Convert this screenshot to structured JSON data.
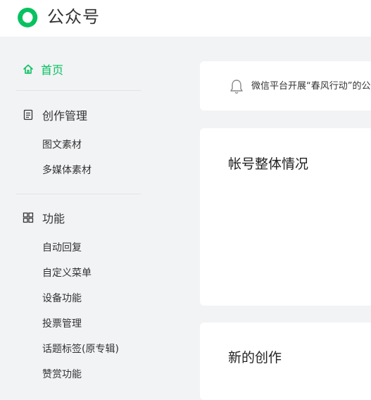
{
  "brand": {
    "name": "公众号",
    "color": "#07c160",
    "logo_icon": "wechat-official-account-logo"
  },
  "sidebar": {
    "home": {
      "label": "首页",
      "icon": "home-icon",
      "active": true
    },
    "groups": [
      {
        "label": "创作管理",
        "icon": "document-icon",
        "items": [
          {
            "label": "图文素材"
          },
          {
            "label": "多媒体素材"
          }
        ]
      },
      {
        "label": "功能",
        "icon": "grid-icon",
        "items": [
          {
            "label": "自动回复"
          },
          {
            "label": "自定义菜单"
          },
          {
            "label": "设备功能"
          },
          {
            "label": "投票管理"
          },
          {
            "label": "话题标签(原专辑)"
          },
          {
            "label": "赞赏功能"
          }
        ]
      }
    ]
  },
  "main": {
    "notice": {
      "icon": "bell-icon",
      "text": "微信平台开展“春风行动”的公"
    },
    "overview": {
      "title": "帐号整体情况"
    },
    "creation": {
      "title": "新的创作"
    }
  }
}
